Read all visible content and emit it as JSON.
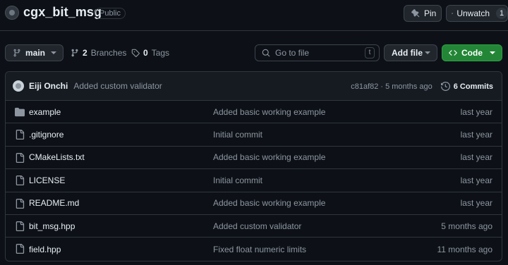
{
  "repo": {
    "name": "cgx_bit_msg",
    "visibility": "Public"
  },
  "header_actions": {
    "pin_label": "Pin",
    "unwatch_label": "Unwatch",
    "watch_count": "1"
  },
  "toolbar": {
    "branch": "main",
    "branches_count": "2",
    "branches_label": "Branches",
    "tags_count": "0",
    "tags_label": "Tags",
    "goto_placeholder": "Go to file",
    "goto_shortcut": "t",
    "add_file_label": "Add file",
    "code_label": "Code"
  },
  "latest_commit": {
    "author": "Eiji Onchi",
    "message": "Added custom validator",
    "hash": "c81af82",
    "separator": "·",
    "time": "5 months ago",
    "commits_label": "6 Commits"
  },
  "files": [
    {
      "icon": "folder-icon",
      "name": "example",
      "message": "Added basic working example",
      "date": "last year"
    },
    {
      "icon": "file-icon",
      "name": ".gitignore",
      "message": "Initial commit",
      "date": "last year"
    },
    {
      "icon": "file-icon",
      "name": "CMakeLists.txt",
      "message": "Added basic working example",
      "date": "last year"
    },
    {
      "icon": "file-icon",
      "name": "LICENSE",
      "message": "Initial commit",
      "date": "last year"
    },
    {
      "icon": "file-icon",
      "name": "README.md",
      "message": "Added basic working example",
      "date": "last year"
    },
    {
      "icon": "file-icon",
      "name": "bit_msg.hpp",
      "message": "Added custom validator",
      "date": "5 months ago"
    },
    {
      "icon": "file-icon",
      "name": "field.hpp",
      "message": "Fixed float numeric limits",
      "date": "11 months ago"
    }
  ],
  "colors": {
    "background": "#0d1117",
    "border": "#30363d",
    "accent_green": "#238636",
    "muted_text": "#8d96a0"
  }
}
